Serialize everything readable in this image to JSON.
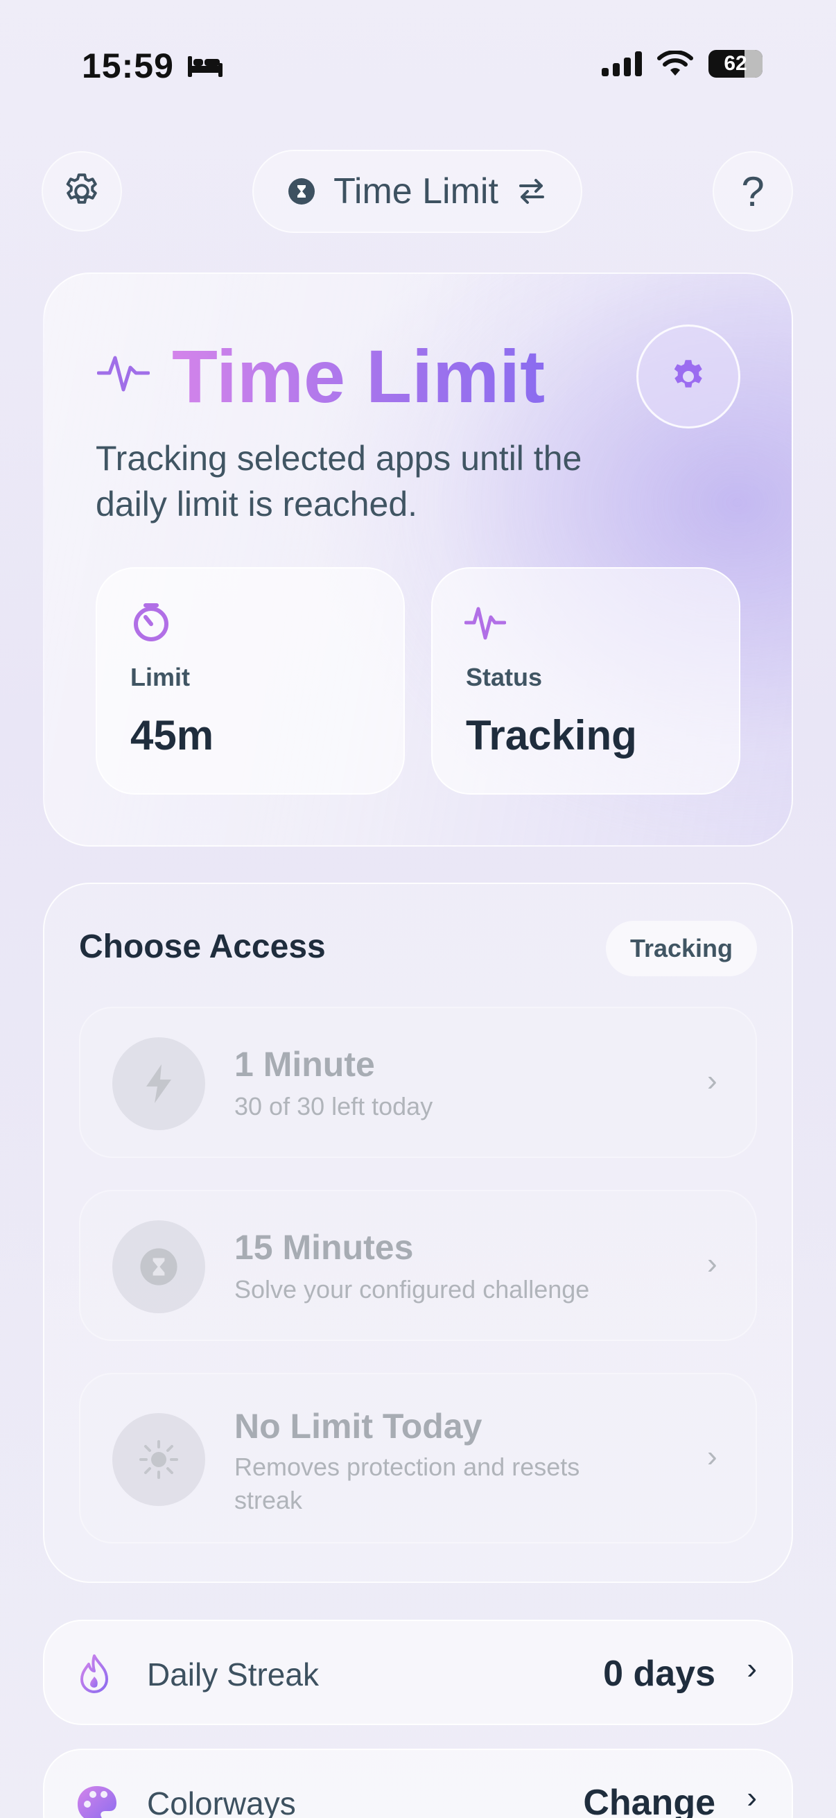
{
  "status_bar": {
    "time": "15:59",
    "battery": "62"
  },
  "nav": {
    "title": "Time Limit"
  },
  "hero": {
    "title": "Time Limit",
    "subtitle": "Tracking selected apps until the daily limit is reached.",
    "stats": [
      {
        "label": "Limit",
        "value": "45m"
      },
      {
        "label": "Status",
        "value": "Tracking"
      }
    ]
  },
  "access": {
    "title": "Choose Access",
    "badge": "Tracking",
    "options": [
      {
        "title": "1 Minute",
        "subtitle": "30 of 30 left today",
        "icon": "bolt-icon"
      },
      {
        "title": "15 Minutes",
        "subtitle": "Solve your configured challenge",
        "icon": "hourglass-icon"
      },
      {
        "title": "No Limit Today",
        "subtitle": "Removes protection and resets streak",
        "icon": "sun-icon"
      }
    ]
  },
  "rows": [
    {
      "label": "Daily Streak",
      "value": "0 days",
      "icon": "flame-icon"
    },
    {
      "label": "Colorways",
      "value": "Change",
      "icon": "palette-icon"
    }
  ],
  "colors": {
    "accent": "#9b6cf0",
    "accent_pink": "#d384ea",
    "text": "#1f2d3d",
    "muted": "#405563"
  }
}
